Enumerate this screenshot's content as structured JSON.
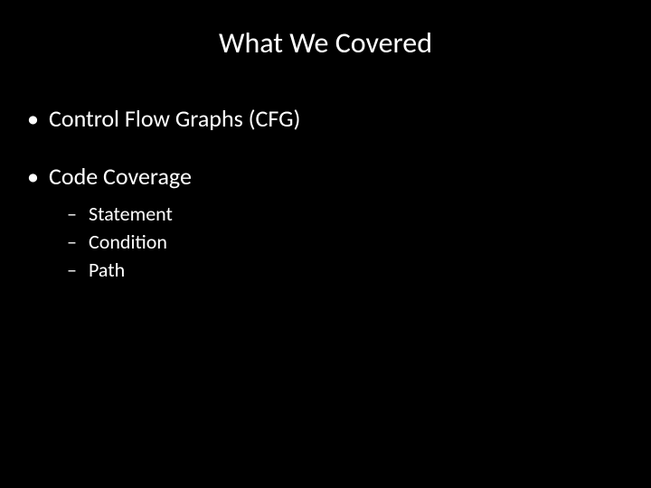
{
  "title": "What We Covered",
  "bullets": {
    "item1": "Control Flow Graphs (CFG)",
    "item2": "Code Coverage",
    "sub1": "Statement",
    "sub2": "Condition",
    "sub3": "Path"
  },
  "marks": {
    "dot": "•",
    "dash": "–"
  }
}
